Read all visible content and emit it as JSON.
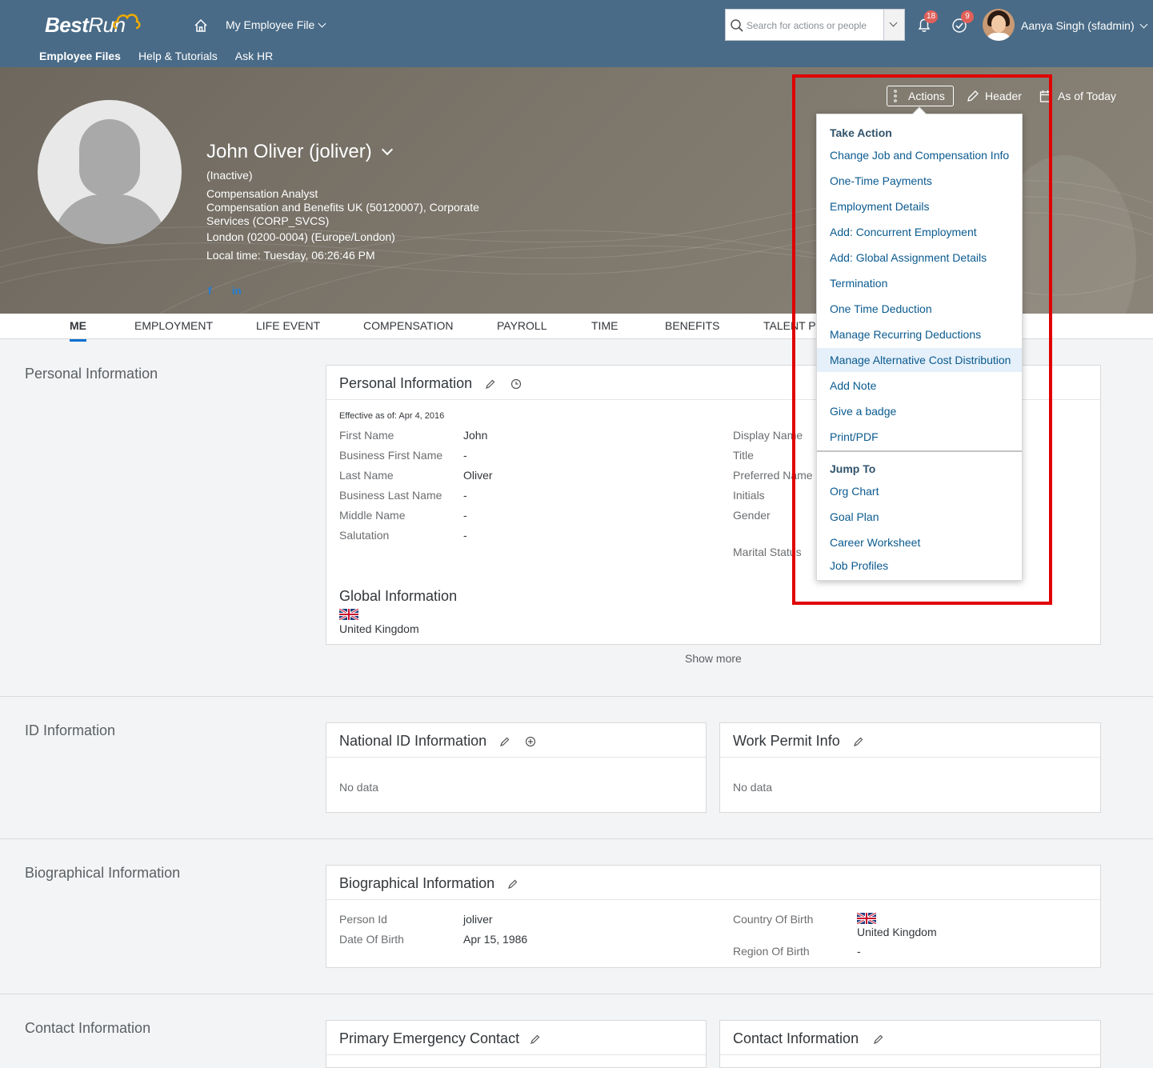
{
  "shell": {
    "logo_bold": "Best",
    "logo_light": "Run",
    "module": "My Employee File",
    "subnav": [
      "Employee Files",
      "Help & Tutorials",
      "Ask HR"
    ],
    "search_placeholder": "Search for actions or people",
    "notifications_count": "18",
    "tasks_count": "9",
    "user_name": "Aanya Singh (sfadmin)"
  },
  "header": {
    "name": "John Oliver (joliver)",
    "status": "(Inactive)",
    "job_title": "Compensation Analyst",
    "department_line1": "Compensation and Benefits UK (50120007), Corporate",
    "department_line2": "Services (CORP_SVCS)",
    "location": "London (0200-0004) (Europe/London)",
    "local_time": "Local time: Tuesday, 06:26:46 PM",
    "social": [
      "f",
      "in"
    ],
    "actions_label": "Actions",
    "header_label": "Header",
    "as_of_label": "As of Today"
  },
  "tabs": [
    "ME",
    "EMPLOYMENT",
    "LIFE EVENT",
    "COMPENSATION",
    "PAYROLL",
    "TIME",
    "BENEFITS",
    "TALENT PR"
  ],
  "personal": {
    "section_title": "Personal Information",
    "card_title": "Personal Information",
    "effective": "Effective as of: Apr 4, 2016",
    "fields": [
      {
        "label": "First Name",
        "value": "John"
      },
      {
        "label": "Business First Name",
        "value": "-"
      },
      {
        "label": "Last Name",
        "value": "Oliver"
      },
      {
        "label": "Business Last Name",
        "value": "-"
      },
      {
        "label": "Middle Name",
        "value": "-"
      },
      {
        "label": "Salutation",
        "value": "-"
      }
    ],
    "right_labels": [
      "Display Name",
      "Title",
      "Preferred Name",
      "Initials",
      "Gender",
      "Marital Status"
    ],
    "global_title": "Global Information",
    "global_country": "United Kingdom",
    "show_more": "Show more"
  },
  "id_info": {
    "section_title": "ID Information",
    "national_title": "National ID Information",
    "national_nodata": "No data",
    "permit_title": "Work Permit Info",
    "permit_nodata": "No data"
  },
  "bio": {
    "section_title": "Biographical Information",
    "card_title": "Biographical Information",
    "person_id_label": "Person Id",
    "person_id": "joliver",
    "dob_label": "Date Of Birth",
    "dob": "Apr 15, 1986",
    "cob_label": "Country Of Birth",
    "cob": "United Kingdom",
    "rob_label": "Region Of Birth",
    "rob": "-"
  },
  "contact": {
    "section_title": "Contact Information",
    "emergency_title": "Primary Emergency Contact",
    "contact_title": "Contact Information"
  },
  "menu": {
    "group1": "Take Action",
    "items1": [
      "Change Job and Compensation Info",
      "One-Time Payments",
      "Employment Details",
      "Add: Concurrent Employment",
      "Add: Global Assignment Details",
      "Termination",
      "One Time Deduction",
      "Manage Recurring Deductions",
      "Manage Alternative Cost Distribution",
      "Add Note",
      "Give a badge",
      "Print/PDF"
    ],
    "group2": "Jump To",
    "items2": [
      "Org Chart",
      "Goal Plan",
      "Career Worksheet",
      "Job Profiles"
    ]
  },
  "colors": {
    "shell": "#496b87",
    "link": "#0a5a8f",
    "highlight": "#e00000"
  }
}
